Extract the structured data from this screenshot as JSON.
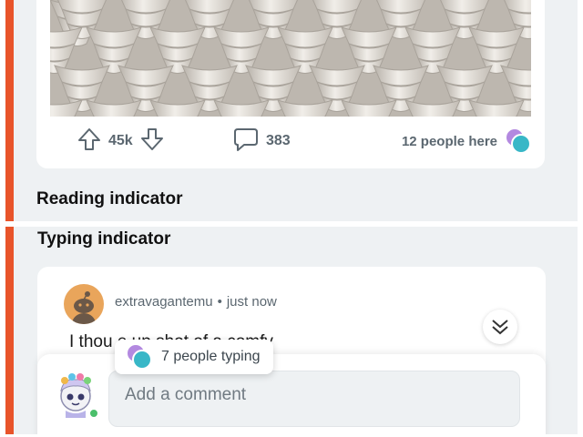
{
  "reading_section": {
    "title": "Reading indicator",
    "post": {
      "upvotes": "45k",
      "comments": "383",
      "presence": "12 people here"
    }
  },
  "typing_section": {
    "title": "Typing indicator",
    "comment": {
      "username": "extravagantemu",
      "separator": "•",
      "time": "just now",
      "text": "I thou                              e up shot of a comfy"
    },
    "composer": {
      "placeholder": "Add a comment",
      "typing_status": "7 people typing"
    }
  },
  "colors": {
    "accent": "#e8542a",
    "panel_bg": "#eef1f3",
    "online": "#4bbf6b",
    "avatar_teal": "#38b7c7",
    "avatar_purple": "#b389e0"
  }
}
